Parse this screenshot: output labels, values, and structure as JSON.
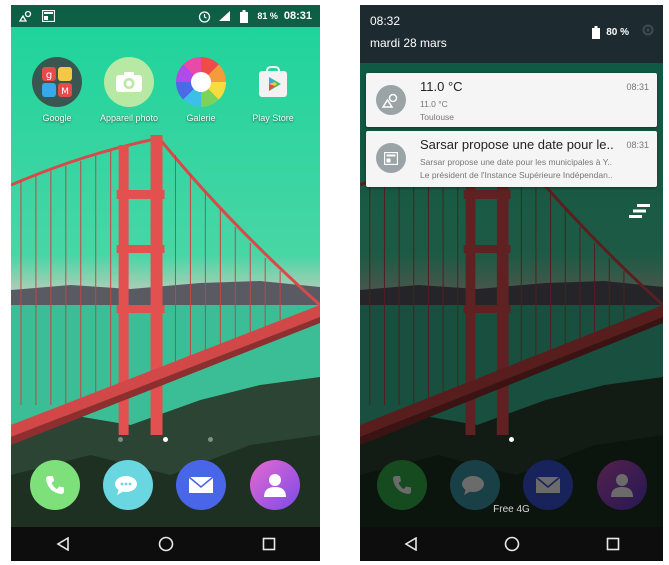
{
  "left_screen": {
    "status_bar": {
      "battery_percent": "81 %",
      "time": "08:31"
    },
    "apps": [
      {
        "label": "Google",
        "icon": "google-folder-icon"
      },
      {
        "label": "Appareil photo",
        "icon": "camera-icon"
      },
      {
        "label": "Galerie",
        "icon": "gallery-icon"
      },
      {
        "label": "Play Store",
        "icon": "play-store-icon"
      }
    ],
    "dock": [
      {
        "icon": "phone-icon",
        "color": "#7ee07a"
      },
      {
        "icon": "messages-icon",
        "color": "#6ad6e0"
      },
      {
        "icon": "email-icon",
        "color": "#4a66e8"
      },
      {
        "icon": "contacts-icon",
        "color": "#c45ce0"
      }
    ]
  },
  "right_screen": {
    "shade": {
      "time": "08:32",
      "date": "mardi 28 mars",
      "battery_percent": "80 %"
    },
    "notifications": [
      {
        "title": "11.0 °C",
        "time": "08:31",
        "lines": [
          "11.0 °C",
          "Toulouse"
        ],
        "icon": "weather-icon"
      },
      {
        "title": "Sarsar propose une date pour le..",
        "time": "08:31",
        "lines": [
          "Sarsar propose une date pour les municipales à Y..",
          "Le président de l'Instance Supérieure Indépendan.."
        ],
        "icon": "news-icon"
      }
    ],
    "carrier": "Free 4G"
  },
  "colors": {
    "sky": "#2fd3a3",
    "bridge": "#e2504f",
    "water": "#3bbd95",
    "shade_header": "#1d2a30"
  }
}
